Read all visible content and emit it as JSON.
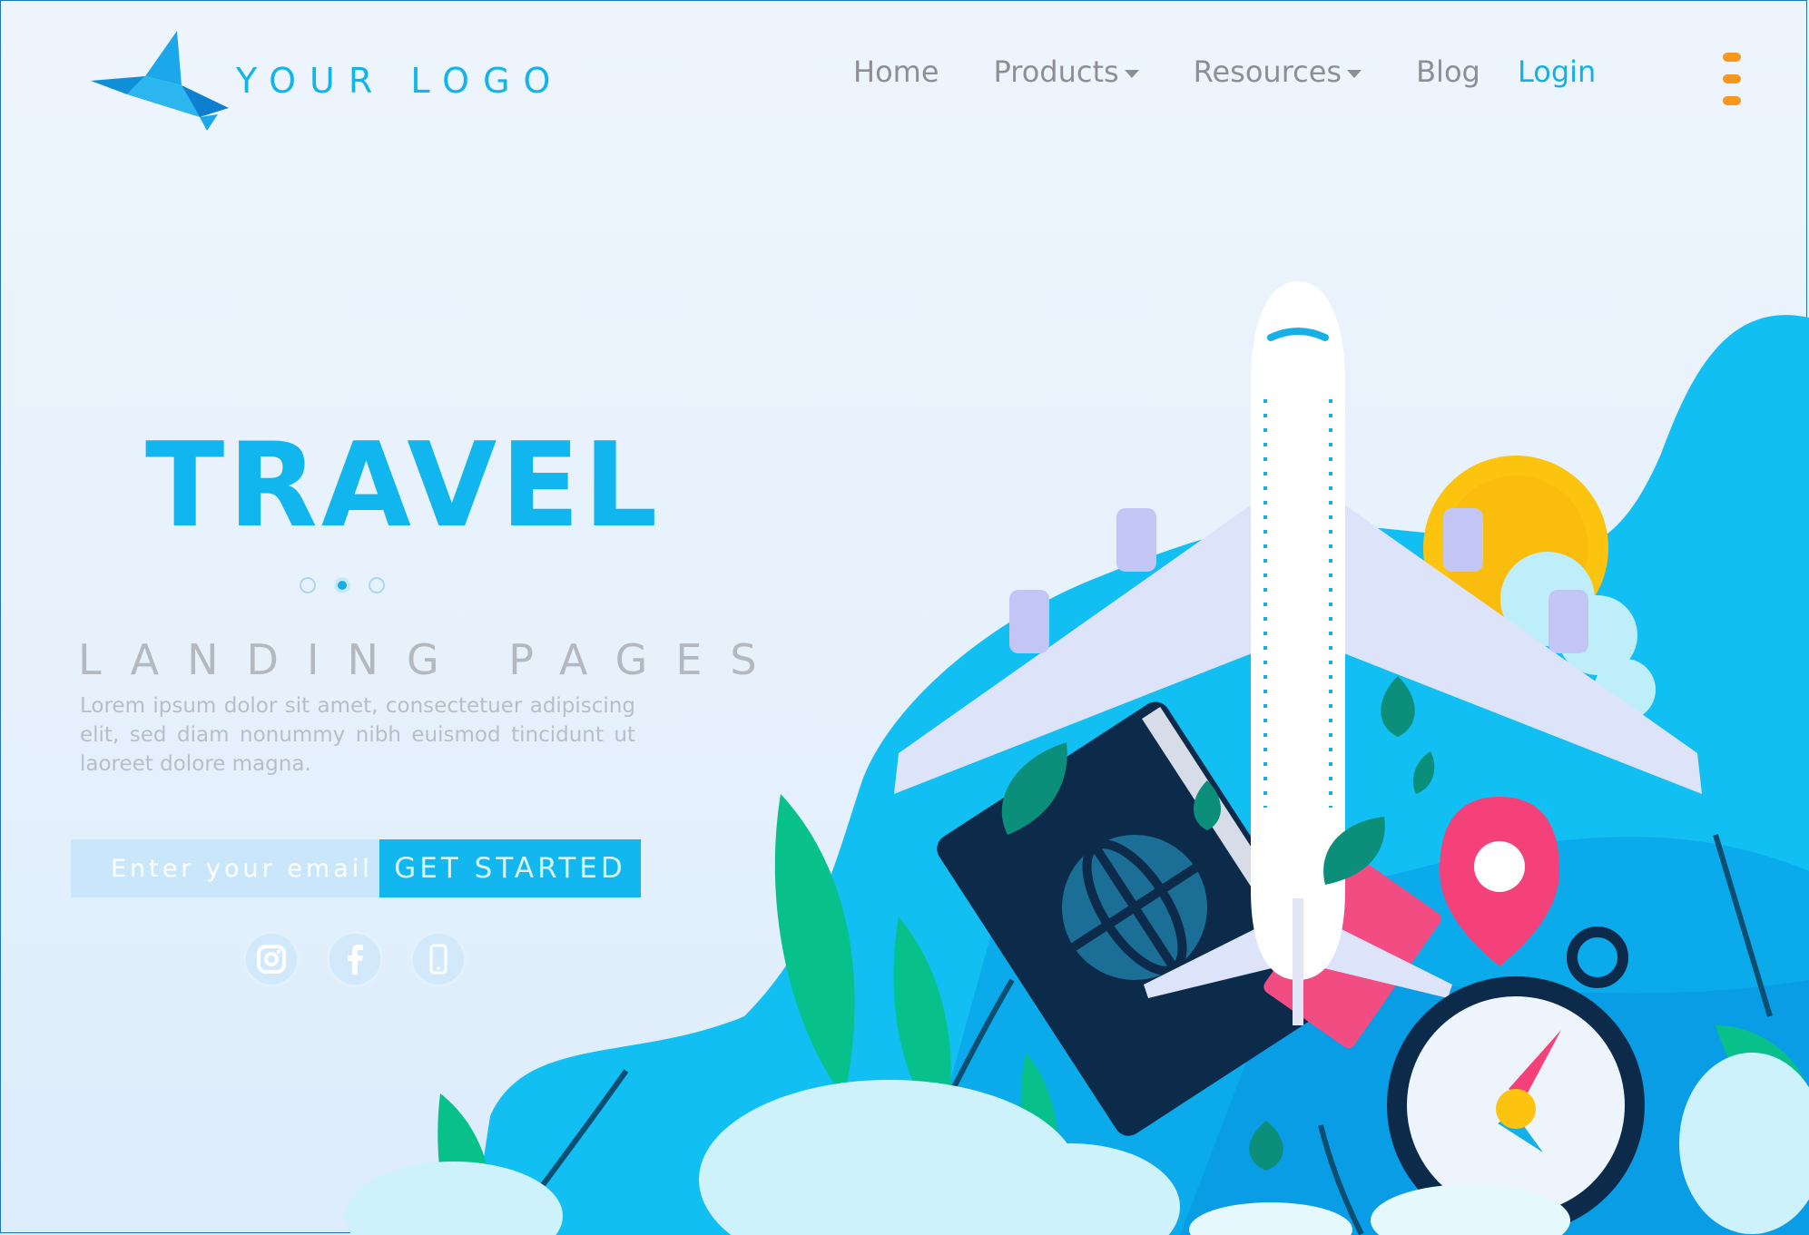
{
  "header": {
    "logo_text": "YOUR LOGO",
    "nav": [
      {
        "label": "Home",
        "dropdown": false
      },
      {
        "label": "Products",
        "dropdown": true
      },
      {
        "label": "Resources",
        "dropdown": true
      },
      {
        "label": "Blog",
        "dropdown": false
      }
    ],
    "login_label": "Login",
    "menu_icon": "hamburger-menu-icon"
  },
  "hero": {
    "title": "TRAVEL",
    "slides_count": 3,
    "active_slide": 2,
    "subtitle": "LANDING PAGES",
    "body": "Lorem ipsum dolor sit amet, consectetuer adipiscing elit, sed diam nonummy nibh euismod tincidunt ut laoreet dolore magna.",
    "email_placeholder": "Enter your email",
    "cta_label": "GET STARTED"
  },
  "socials": [
    {
      "icon": "instagram-icon"
    },
    {
      "icon": "facebook-icon"
    },
    {
      "icon": "phone-icon"
    }
  ],
  "colors": {
    "accent": "#12b7ef",
    "menu_icon": "#f9961c",
    "text_muted": "#8d8f94"
  }
}
